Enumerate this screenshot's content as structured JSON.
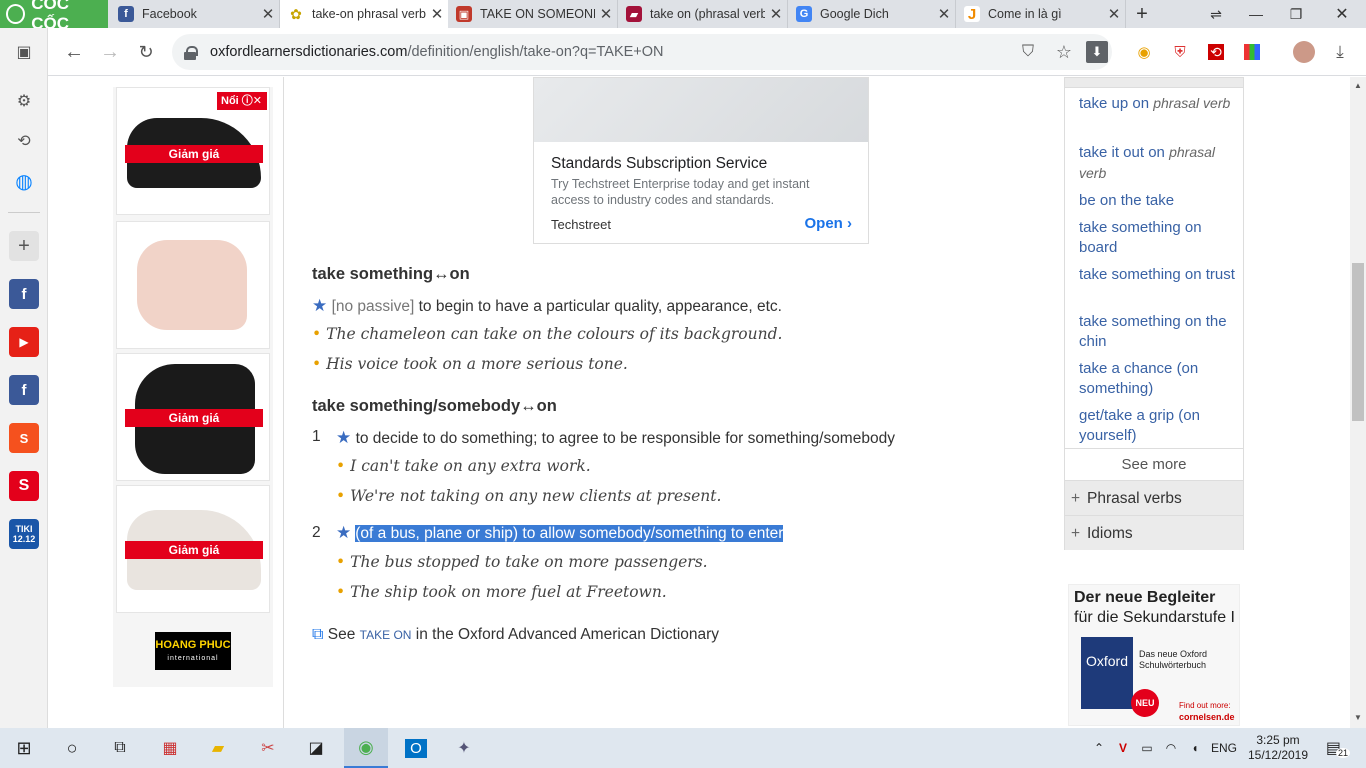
{
  "browser": {
    "brand": "CỐC CỐC",
    "tabs": [
      {
        "title": "Facebook",
        "icon": "facebook-icon",
        "color": "#3b5998"
      },
      {
        "title": "take-on phrasal verb",
        "icon": "oxford-icon",
        "color": "#c7a500",
        "active": true
      },
      {
        "title": "TAKE ON SOMEONE/",
        "icon": "cambridge-icon",
        "color": "#c0392b"
      },
      {
        "title": "take on (phrasal verb",
        "icon": "book-icon",
        "color": "#a3123a"
      },
      {
        "title": "Google Dich",
        "icon": "google-translate-icon",
        "color": "#4285f4"
      },
      {
        "title": "Come in là gì",
        "icon": "j-icon",
        "color": "#f08a00"
      }
    ],
    "url_host": "oxfordlearnersdictionaries.com",
    "url_path": "/definition/english/take-on?q=TAKE+ON"
  },
  "ads": {
    "left_badge": "Nổi",
    "sale_label": "Giảm giá",
    "hoangphuc": "HOANG PHUC",
    "hoangphuc_sub": "international",
    "card_title": "Standards Subscription Service",
    "card_desc": "Try Techstreet Enterprise today and get instant access to industry codes and standards.",
    "card_source": "Techstreet",
    "card_cta": "Open",
    "right_title1": "Der neue Begleiter",
    "right_title2": "für die Sekundarstufe I",
    "right_book": "Oxford",
    "right_book_sub": "Das neue Oxford Schulwörterbuch",
    "right_neu": "NEU",
    "right_find": "Find out more:",
    "right_site": "cornelsen.de"
  },
  "entry": {
    "sense1_hw": "take something↔on",
    "sense1_gram": "[no passive]",
    "sense1_def": "to begin to have a particular quality, appearance, etc.",
    "sense1_ex1": "The chameleon can take on the colours of its background.",
    "sense1_ex2": "His voice took on a more serious tone.",
    "sense2_hw": "take something/somebody↔on",
    "n1": "1",
    "n1_def": "to decide to do something; to agree to be responsible for something/somebody",
    "n1_ex1": "I can't take on any extra work.",
    "n1_ex2": "We're not taking on any new clients at present.",
    "n2": "2",
    "n2_def": "(of a bus, plane or ship) to allow somebody/something to enter",
    "n2_ex1": "The bus stopped to take on more passengers.",
    "n2_ex2": "The ship took on more fuel at Freetown.",
    "see_prefix": "See",
    "see_word": "TAKE ON",
    "see_suffix": "in the Oxford Advanced American Dictionary"
  },
  "related": {
    "items": [
      {
        "text": "take up on",
        "pos": "phrasal verb"
      },
      {
        "text": "take it out on",
        "pos": "phrasal verb"
      },
      {
        "text": "be on the take",
        "pos": ""
      },
      {
        "text": "take something on board",
        "pos": ""
      },
      {
        "text": "take something on trust",
        "pos": ""
      },
      {
        "text": "take something on the chin",
        "pos": ""
      },
      {
        "text": "take a chance (on something)",
        "pos": ""
      },
      {
        "text": "get/take a grip (on yourself)",
        "pos": ""
      }
    ],
    "see_more": "See more",
    "sections": [
      "Phrasal verbs",
      "Idioms"
    ]
  },
  "taskbar": {
    "lang": "ENG",
    "time": "3:25 pm",
    "date": "15/12/2019",
    "notif": "21"
  },
  "sidebar": {
    "tiki": "TIKI",
    "tiki_date": "12.12"
  }
}
